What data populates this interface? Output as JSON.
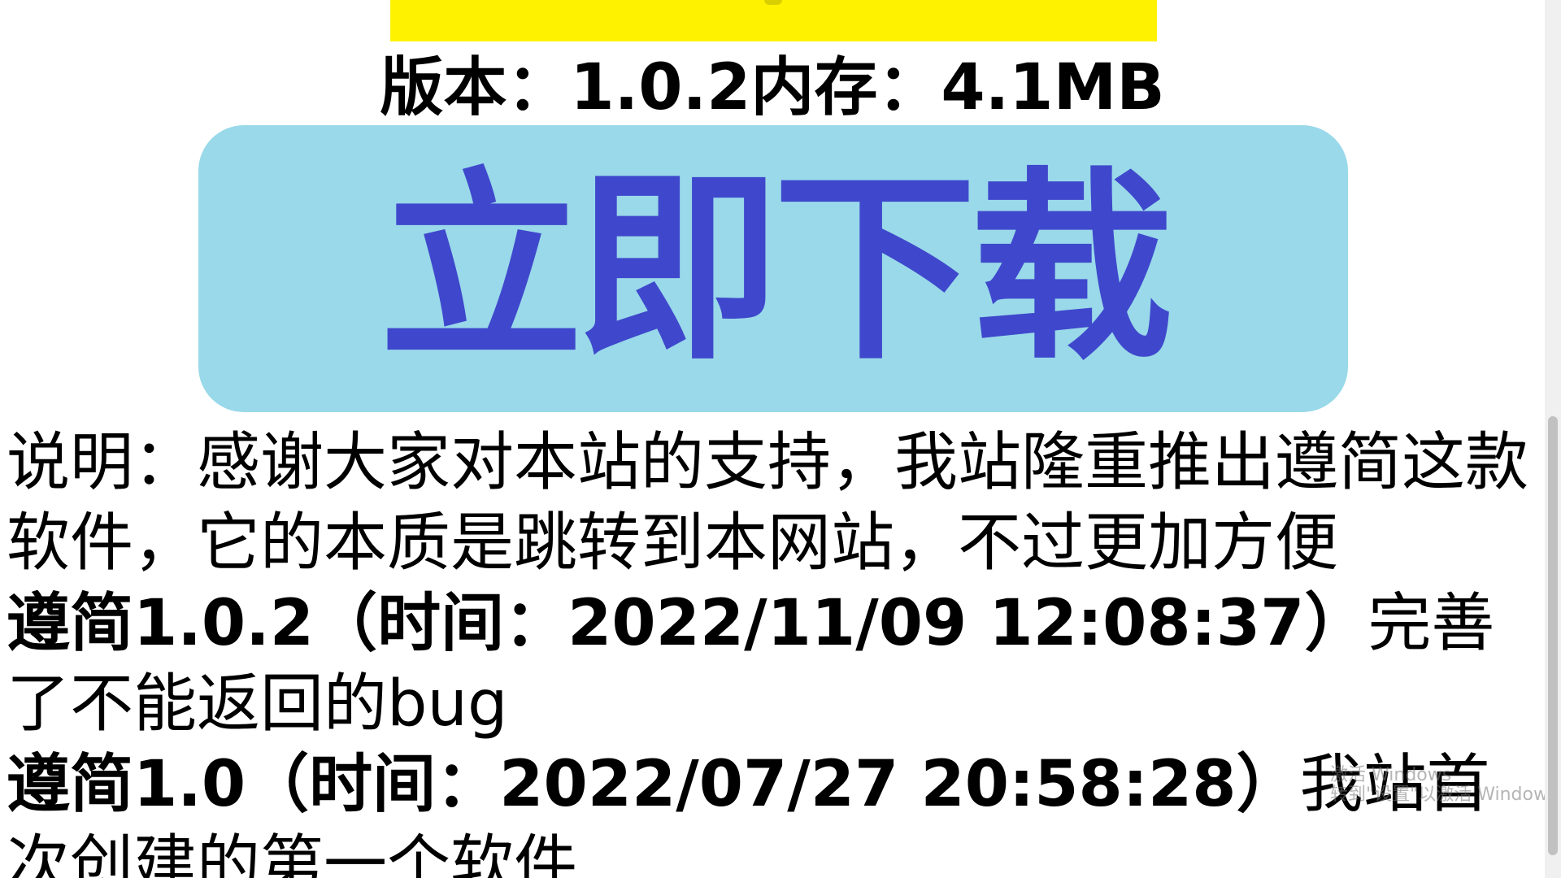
{
  "colors": {
    "banner": "#fff200",
    "button_bg": "#99d9ea",
    "button_text": "#3f48cc",
    "text": "#000000"
  },
  "version_line": "版本：1.0.2内存：4.1MB",
  "download_button": {
    "label": "立即下载"
  },
  "description": {
    "intro": "说明：感谢大家对本站的支持，我站隆重推出遵简这款软件，它的本质是跳转到本网站，不过更加方便"
  },
  "changelog": [
    {
      "title": "遵简1.0.2（时间：2022/11/09 12:08:37）",
      "text": "完善了不能返回的bug"
    },
    {
      "title": "遵简1.0（时间：2022/07/27 20:58:28）",
      "text": "我站首次创建的第一个软件"
    }
  ],
  "watermark": {
    "line1": "激活 Windows",
    "line2": "转到\"设置\"以激活 Windows。"
  }
}
